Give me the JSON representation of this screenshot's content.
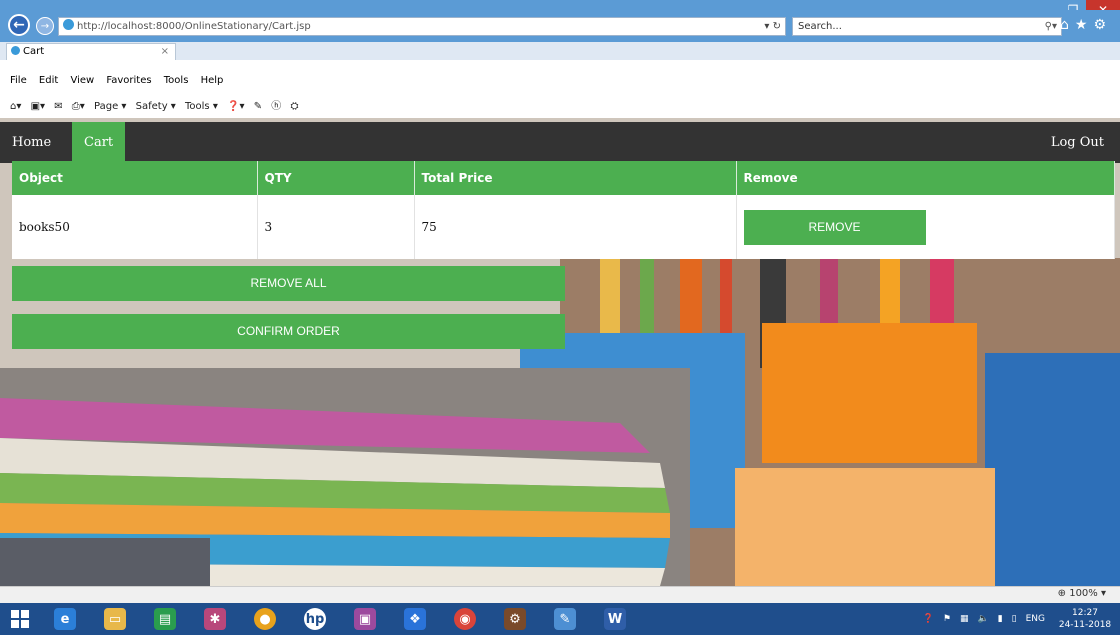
{
  "browser": {
    "address_url": "http://localhost:8000/OnlineStationary/Cart.jsp",
    "address_controls": "▾ ↻",
    "search_placeholder": "Search...",
    "tab_title": "Cart",
    "tab_close": "×",
    "menu": [
      "File",
      "Edit",
      "View",
      "Favorites",
      "Tools",
      "Help"
    ],
    "commands": [
      "Page ▾",
      "Safety ▾",
      "Tools ▾"
    ],
    "zoom": "100%"
  },
  "nav": {
    "home": "Home",
    "cart": "Cart",
    "logout": "Log Out"
  },
  "table": {
    "headers": [
      "Object",
      "QTY",
      "Total Price",
      "Remove"
    ],
    "rows": [
      {
        "object": "books50",
        "qty": "3",
        "total": "75",
        "remove_label": "REMOVE"
      }
    ]
  },
  "buttons": {
    "remove_all": "REMOVE ALL",
    "confirm": "CONFIRM ORDER"
  },
  "taskbar": {
    "lang": "ENG",
    "time": "12:27",
    "date": "24-11-2018"
  },
  "colors": {
    "accent": "#4caf50",
    "nav": "#333333",
    "titlebar": "#5b9bd5",
    "taskbar": "#1f4e8c"
  }
}
